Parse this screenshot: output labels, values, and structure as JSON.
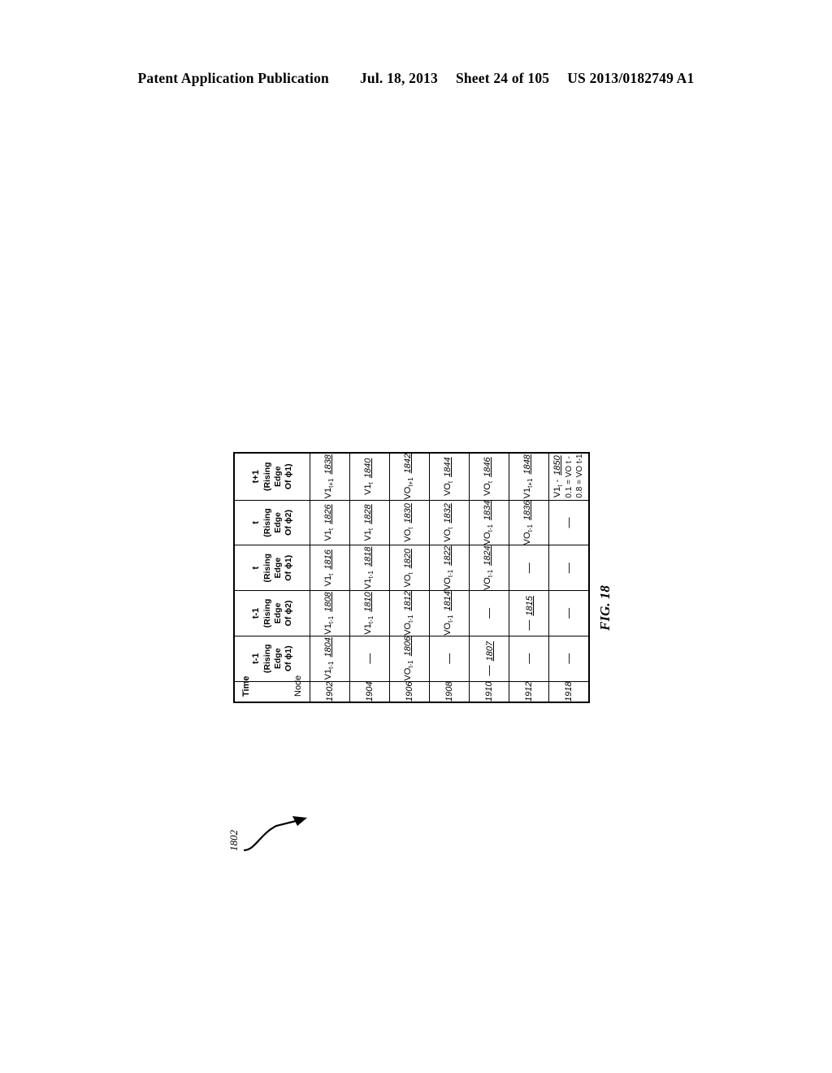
{
  "header": {
    "publication": "Patent Application Publication",
    "date": "Jul. 18, 2013",
    "sheet": "Sheet 24 of 105",
    "patent_number": "US 2013/0182749 A1"
  },
  "figure": {
    "label": "FIG. 18",
    "callout_ref": "1802"
  },
  "table": {
    "stub_time_label": "Time",
    "stub_node_label": "Node",
    "columns": [
      {
        "time": "t-1",
        "edge_line1": "(Rising Edge",
        "edge_line2": "Of ϕ1)"
      },
      {
        "time": "t-1",
        "edge_line1": "(Rising Edge",
        "edge_line2": "Of ϕ2)"
      },
      {
        "time": "t",
        "edge_line1": "(Rising Edge",
        "edge_line2": "Of ϕ1)"
      },
      {
        "time": "t",
        "edge_line1": "(Rising Edge",
        "edge_line2": "Of ϕ2)"
      },
      {
        "time": "t+1",
        "edge_line1": "(Rising Edge",
        "edge_line2": "Of ϕ1)"
      }
    ],
    "rows": [
      {
        "node": "1902",
        "cells": [
          {
            "value": "V1",
            "sub": "t-1",
            "ref": "1804"
          },
          {
            "value": "V1",
            "sub": "t-1",
            "ref": "1808"
          },
          {
            "value": "V1",
            "sub": "t",
            "ref": "1816"
          },
          {
            "value": "V1",
            "sub": "t",
            "ref": "1826"
          },
          {
            "value": "V1",
            "sub": "t+1",
            "ref": "1838"
          }
        ]
      },
      {
        "node": "1904",
        "cells": [
          {
            "value": "—",
            "sub": "",
            "ref": ""
          },
          {
            "value": "V1",
            "sub": "t-1",
            "ref": "1810"
          },
          {
            "value": "V1",
            "sub": "t-1",
            "ref": "1818"
          },
          {
            "value": "V1",
            "sub": "t",
            "ref": "1828"
          },
          {
            "value": "V1",
            "sub": "t",
            "ref": "1840"
          }
        ]
      },
      {
        "node": "1906",
        "cells": [
          {
            "value": "VO",
            "sub": "t-1",
            "ref": "1806"
          },
          {
            "value": "VO",
            "sub": "t-1",
            "ref": "1812"
          },
          {
            "value": "VO",
            "sub": "t",
            "ref": "1820"
          },
          {
            "value": "VO",
            "sub": "t",
            "ref": "1830"
          },
          {
            "value": "VO",
            "sub": "t+1",
            "ref": "1842"
          }
        ]
      },
      {
        "node": "1908",
        "cells": [
          {
            "value": "—",
            "sub": "",
            "ref": ""
          },
          {
            "value": "VO",
            "sub": "t-1",
            "ref": "1814"
          },
          {
            "value": "VO",
            "sub": "t-1",
            "ref": "1822"
          },
          {
            "value": "VO",
            "sub": "t",
            "ref": "1832"
          },
          {
            "value": "VO",
            "sub": "t",
            "ref": "1844"
          }
        ]
      },
      {
        "node": "1910",
        "cells": [
          {
            "value": "—",
            "sub": "",
            "ref": "1807"
          },
          {
            "value": "—",
            "sub": "",
            "ref": ""
          },
          {
            "value": "VO",
            "sub": "t-1",
            "ref": "1824"
          },
          {
            "value": "VO",
            "sub": "t-1",
            "ref": "1834"
          },
          {
            "value": "VO",
            "sub": "t",
            "ref": "1846"
          }
        ]
      },
      {
        "node": "1912",
        "cells": [
          {
            "value": "—",
            "sub": "",
            "ref": ""
          },
          {
            "value": "—",
            "sub": "",
            "ref": "1815"
          },
          {
            "value": "—",
            "sub": "",
            "ref": ""
          },
          {
            "value": "VO",
            "sub": "t-1",
            "ref": "1836"
          },
          {
            "value": "V1",
            "sub": "t+1",
            "ref": "1848"
          }
        ]
      },
      {
        "node": "1918",
        "cells": [
          {
            "value": "—",
            "sub": "",
            "ref": ""
          },
          {
            "value": "—",
            "sub": "",
            "ref": ""
          },
          {
            "value": "—",
            "sub": "",
            "ref": ""
          },
          {
            "value": "—",
            "sub": "",
            "ref": ""
          },
          {
            "value": "V1",
            "sub": "t",
            "suffix": " -",
            "ref": "1850",
            "equations": [
              "0.1 = VO t -",
              "0.8 = VO t-1"
            ]
          }
        ]
      }
    ]
  }
}
